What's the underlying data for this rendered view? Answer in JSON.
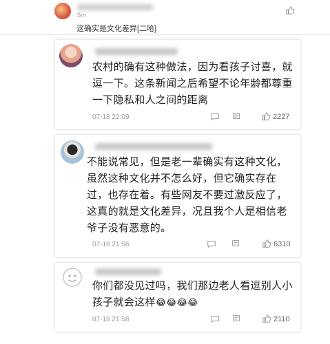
{
  "top_comment": {
    "time": "5m",
    "text": "这确实是文化差异[二哈]"
  },
  "comments": [
    {
      "text": "农村的确有这种做法，因为看孩子讨喜，就\n逗一下。这条新闻之后希望不论年龄都尊重\n一下隐私和人之间的距离",
      "time": "07-18 22:09",
      "likes": "2227"
    },
    {
      "text": "不能说常见，但是老一辈确实有这种文化，\n虽然这种文化并不怎么好，但它确实存在\n过，也存在着。有些网友不要过激反应了，\n这真的就是文化差异，况且我个人是相信老\n爷子没有恶意的。",
      "time": "07-18 21:56",
      "likes": "6310"
    },
    {
      "text": "你们都没见过吗，我们那边老人看逗别人小\n孩子就会这样",
      "emoji": "😂😂😂😂",
      "time": "07-18 21:58",
      "likes": "2110"
    }
  ],
  "icons": {
    "like": "thumbs-up-icon",
    "reply": "reply-icon",
    "comment": "comment-icon"
  },
  "colors": {
    "meta_gray": "#9a9a9a",
    "text": "#222222"
  }
}
